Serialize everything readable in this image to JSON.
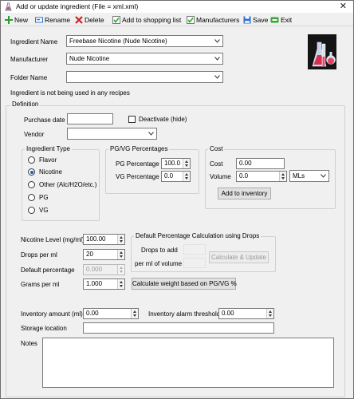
{
  "window": {
    "title": "Add or update ingredient (File = xml.xml)",
    "close_glyph": "✕"
  },
  "toolbar": {
    "new": "New",
    "rename": "Rename",
    "delete": "Delete",
    "add_to_shopping_list": "Add to shopping list",
    "manufacturers": "Manufacturers",
    "save": "Save",
    "exit": "Exit"
  },
  "ingredient": {
    "name_label": "Ingredient Name",
    "name_value": "Freebase Nicotine (Nude Nicotine)",
    "manufacturer_label": "Manufacturer",
    "manufacturer_value": "Nude Nicotine",
    "folder_label": "Folder Name",
    "folder_value": "",
    "usage_note": "Ingredient is not being used in any recipes"
  },
  "definition": {
    "title": "Definition",
    "purchase_date_label": "Purchase date",
    "purchase_date_value": "",
    "deactivate_label": "Deactivate (hide)",
    "deactivate_checked": false,
    "vendor_label": "Vendor",
    "vendor_value": ""
  },
  "ingredient_type": {
    "title": "Ingredient Type",
    "options": [
      "Flavor",
      "Nicotine",
      "Other (Alc/H2O/etc.)",
      "PG",
      "VG"
    ],
    "selected": "Nicotine"
  },
  "pgvg": {
    "title": "PG/VG Percentages",
    "pg_label": "PG Percentage",
    "pg_value": "100.0",
    "vg_label": "VG Percentage",
    "vg_value": "0.0"
  },
  "cost": {
    "title": "Cost",
    "cost_label": "Cost",
    "cost_value": "0.00",
    "volume_label": "Volume",
    "volume_value": "0.0",
    "unit_value": "MLs",
    "add_inventory_button": "Add to inventory"
  },
  "levels": {
    "nicotine_label": "Nicotine Level (mg/ml)",
    "nicotine_value": "100.00",
    "drops_label": "Drops per ml",
    "drops_value": "20",
    "default_pct_label": "Default percentage",
    "default_pct_value": "0.000",
    "grams_label": "Grams per ml",
    "grams_value": "1.000"
  },
  "default_calc": {
    "title": "Default Percentage Calculation using Drops",
    "drops_to_add_label": "Drops to add",
    "per_ml_volume_label": "per ml of volume",
    "calc_button": "Calculate & Update"
  },
  "calc_weight_button": "Calculate weight based on PG/VG %",
  "inventory": {
    "amount_label": "Inventory amount (ml)",
    "amount_value": "0.00",
    "alarm_label": "Inventory alarm threshold",
    "alarm_value": "0.00",
    "storage_label": "Storage location",
    "storage_value": ""
  },
  "notes": {
    "label": "Notes",
    "value": ""
  },
  "colors": {
    "accent": "#0a5fd4",
    "window_bg": "#f0f0f0"
  }
}
